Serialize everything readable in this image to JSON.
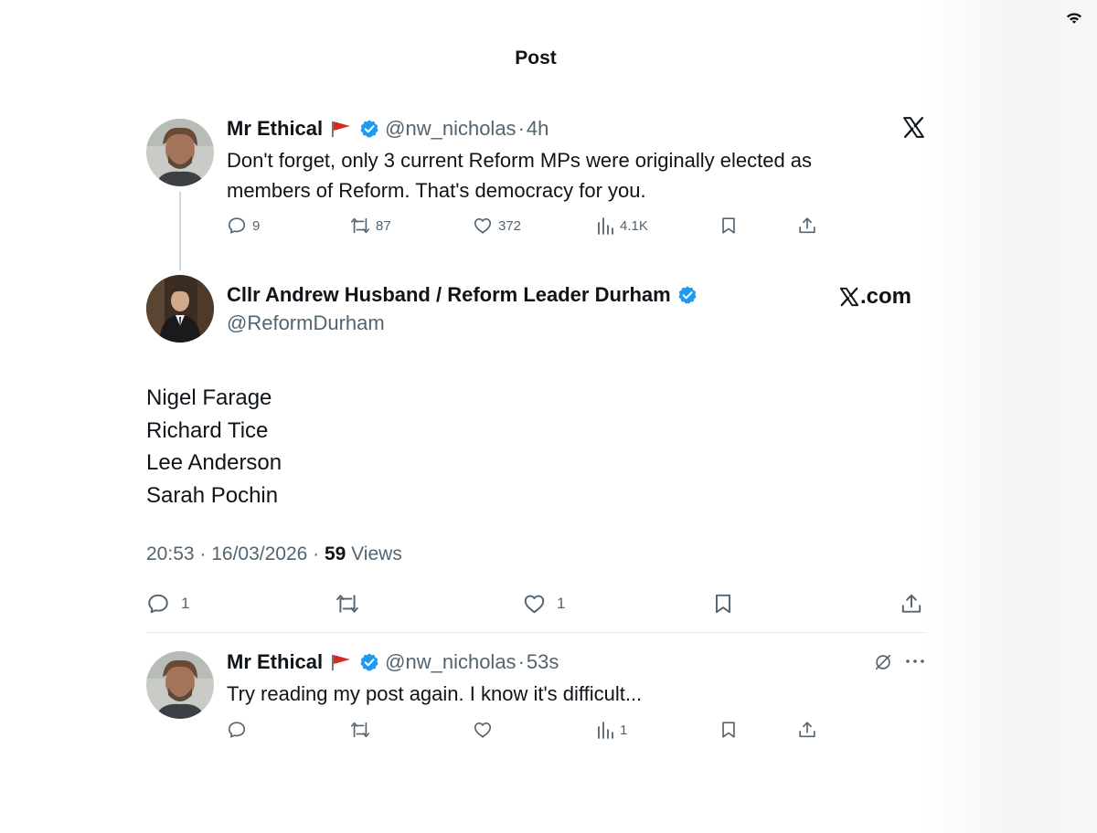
{
  "header": {
    "title": "Post"
  },
  "parent_post": {
    "name": "Mr Ethical",
    "handle": "@nw_nicholas",
    "separator": "·",
    "time": "4h",
    "text_line1": "Don't forget, only 3 current Reform MPs were originally elected as",
    "text_line2": "members of Reform. That's democracy for you.",
    "replies": "9",
    "reposts": "87",
    "likes": "372",
    "views": "4.1K"
  },
  "main_post": {
    "name": "Cllr Andrew Husband / Reform Leader Durham",
    "handle": "@ReformDurham",
    "brand": ".com",
    "lines": [
      "Nigel Farage",
      "Richard Tice",
      "Lee Anderson",
      "Sarah Pochin"
    ],
    "timestamp": "20:53 · 16/03/2026 · ",
    "views_count": "59",
    "views_label": " Views",
    "replies": "1",
    "likes": "1"
  },
  "reply_post": {
    "name": "Mr Ethical",
    "handle": "@nw_nicholas",
    "separator": "·",
    "time": "53s",
    "text": "Try reading my post again.  I know it's difficult...",
    "views": "1"
  },
  "colors": {
    "text": "#0f1419",
    "secondary": "#536471",
    "verified": "#1d9bf0",
    "flag": "#d62a1e",
    "divider": "#e6ebee"
  },
  "icons": [
    "wifi-icon",
    "verified-icon",
    "flag-icon",
    "x-logo-icon",
    "reply-icon",
    "repost-icon",
    "like-icon",
    "views-icon",
    "bookmark-icon",
    "share-icon",
    "grok-icon",
    "more-icon"
  ]
}
